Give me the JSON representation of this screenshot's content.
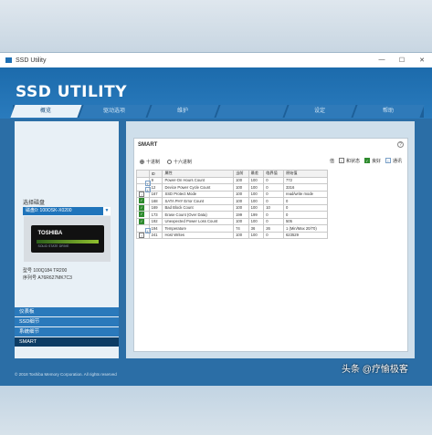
{
  "window": {
    "title": "SSD Utility",
    "minimize": "—",
    "maximize": "☐",
    "close": "✕"
  },
  "app": {
    "logo": "SSD UTILITY"
  },
  "tabs": [
    "概览",
    "驱动选项",
    "维护",
    "",
    "设定",
    "帮助"
  ],
  "sidebar": {
    "drive_label": "选择磁盘",
    "drive_value": "磁盘0: 100OSK-X0200",
    "ssd_brand": "TOSHIBA",
    "ssd_small": "SOLID STATE DRIVE",
    "model": "型号 100Q184 TR200",
    "serial": "序列号 A76R627MK7C3",
    "menu": [
      "仪表板",
      "SSD细节",
      "系统细节",
      "SMART"
    ],
    "active_menu": "SMART"
  },
  "smart": {
    "title": "SMART",
    "radio_dec": "十进制",
    "radio_hex": "十六进制",
    "legend": {
      "prefix": "值",
      "info_label": "和状态",
      "ok_label": "良好",
      "info2_label": "通讯"
    },
    "headers": [
      "",
      "ID",
      "属性",
      "当前",
      "最差",
      "临界值",
      "原始值"
    ],
    "rows": [
      {
        "s": "info",
        "id": "9",
        "name": "Power-On Hours Count",
        "cur": "100",
        "worst": "100",
        "thr": "0",
        "raw": "772"
      },
      {
        "s": "info",
        "id": "12",
        "name": "Device Power Cycle Count",
        "cur": "100",
        "worst": "100",
        "thr": "0",
        "raw": "3316"
      },
      {
        "s": "warn",
        "id": "167",
        "name": "SSD Protect Mode",
        "cur": "100",
        "worst": "100",
        "thr": "0",
        "raw": "read/write mode"
      },
      {
        "s": "ok",
        "id": "168",
        "name": "SATA PHY Error Count",
        "cur": "100",
        "worst": "100",
        "thr": "0",
        "raw": "0"
      },
      {
        "s": "ok",
        "id": "169",
        "name": "Bad Block Count",
        "cur": "100",
        "worst": "100",
        "thr": "10",
        "raw": "0"
      },
      {
        "s": "ok",
        "id": "173",
        "name": "Erase Count (Over Data)",
        "cur": "199",
        "worst": "199",
        "thr": "0",
        "raw": "0"
      },
      {
        "s": "ok",
        "id": "192",
        "name": "Unexpected Power Loss Count",
        "cur": "100",
        "worst": "100",
        "thr": "0",
        "raw": "505"
      },
      {
        "s": "info",
        "id": "194",
        "name": "Temperature",
        "cur": "74",
        "worst": "36",
        "thr": "26",
        "raw": "1 (Min/Max 20/70)"
      },
      {
        "s": "warn",
        "id": "241",
        "name": "Host Writes",
        "cur": "100",
        "worst": "100",
        "thr": "0",
        "raw": "623529"
      }
    ]
  },
  "footer": "© 2018 Toshiba Memory Corporation. All rights reserved",
  "watermark": "头条 @疗愉极客"
}
